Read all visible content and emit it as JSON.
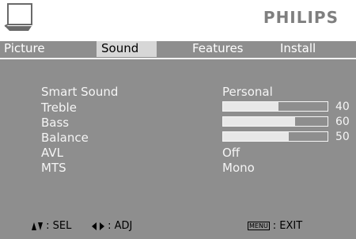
{
  "brand": "PHILIPS",
  "tabs": [
    {
      "label": "Picture",
      "active": false
    },
    {
      "label": "Sound",
      "active": true
    },
    {
      "label": "Features",
      "active": false
    },
    {
      "label": "Install",
      "active": false
    }
  ],
  "settings": {
    "smart_sound": {
      "label": "Smart Sound",
      "value": "Personal"
    },
    "treble": {
      "label": "Treble",
      "value": "40",
      "level": 0.53
    },
    "bass": {
      "label": "Bass",
      "value": "60",
      "level": 0.69
    },
    "balance": {
      "label": "Balance",
      "value": "50",
      "level": 0.63
    },
    "avl": {
      "label": "AVL",
      "value": "Off"
    },
    "mts": {
      "label": "MTS",
      "value": "Mono"
    }
  },
  "footer": {
    "sel_label": ": SEL",
    "adj_label": ": ADJ",
    "menu_key": "MENU",
    "exit_label": ": EXIT"
  },
  "colors": {
    "background": "#8e8e8e",
    "active_tab": "#d7d7d7",
    "brand": "#7f7f7f"
  },
  "icons": [
    "tv-icon",
    "up-down-arrows-icon",
    "left-right-arrows-icon",
    "menu-key-icon"
  ]
}
